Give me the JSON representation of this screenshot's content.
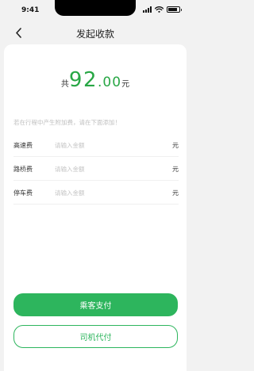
{
  "status_bar": {
    "time": "9:41"
  },
  "nav": {
    "title": "发起收款",
    "back_icon": "chevron-left-icon"
  },
  "total": {
    "prefix": "共",
    "amount_int": "92",
    "amount_dec": ".00",
    "unit": "元"
  },
  "hint": "若在行程中产生附加费，请在下面添加！",
  "fees": [
    {
      "label": "高速费",
      "placeholder": "请输入金额",
      "unit": "元"
    },
    {
      "label": "路桥费",
      "placeholder": "请输入金额",
      "unit": "元"
    },
    {
      "label": "停车费",
      "placeholder": "请输入金额",
      "unit": "元"
    }
  ],
  "buttons": {
    "primary": "乘客支付",
    "secondary": "司机代付"
  },
  "colors": {
    "accent": "#2db55d",
    "page_bg": "#f2f2f2"
  }
}
